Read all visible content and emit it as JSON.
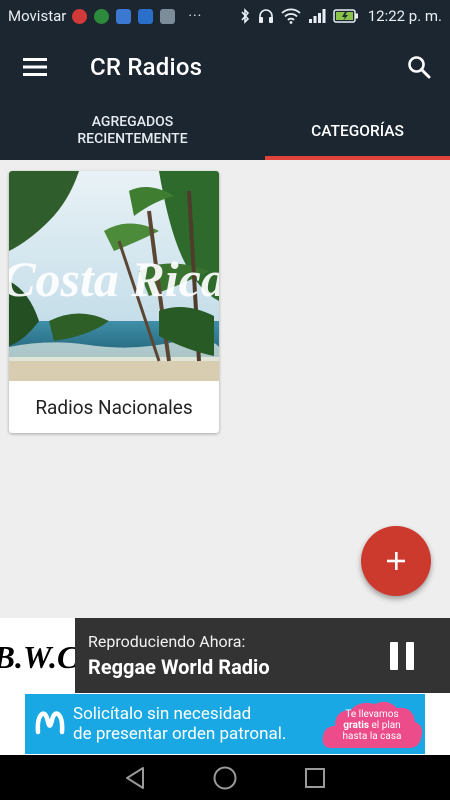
{
  "status_bar": {
    "carrier": "Movistar",
    "dots": "···",
    "time": "12:22 p. m."
  },
  "app_bar": {
    "title": "CR Radios",
    "menu_icon": "hamburger-menu-icon",
    "search_icon": "search-icon"
  },
  "tabs": [
    {
      "label": "AGREGADOS RECIENTEMENTE",
      "selected": false
    },
    {
      "label": "CATEGORÍAS",
      "selected": true
    }
  ],
  "accent_color": "#e0423c",
  "categories": [
    {
      "label": "Radios Nacionales",
      "image_text": "Costa Rica"
    }
  ],
  "fab": {
    "label": "+",
    "icon": "add-icon"
  },
  "player": {
    "label": "Reproduciendo Ahora:",
    "station": "Reggae World Radio",
    "thumb_text": "B.W.C",
    "control_icon": "pause-icon"
  },
  "ad": {
    "line1": "Solicítalo sin necesidad",
    "line2": "de presentar orden patronal.",
    "cloud_line1": "Te llevamos",
    "cloud_bold": "gratis",
    "cloud_line2": "el plan",
    "cloud_line3": "hasta la casa"
  },
  "nav": {
    "back_icon": "back-triangle-icon",
    "home_icon": "home-circle-icon",
    "recents_icon": "recents-square-icon"
  }
}
